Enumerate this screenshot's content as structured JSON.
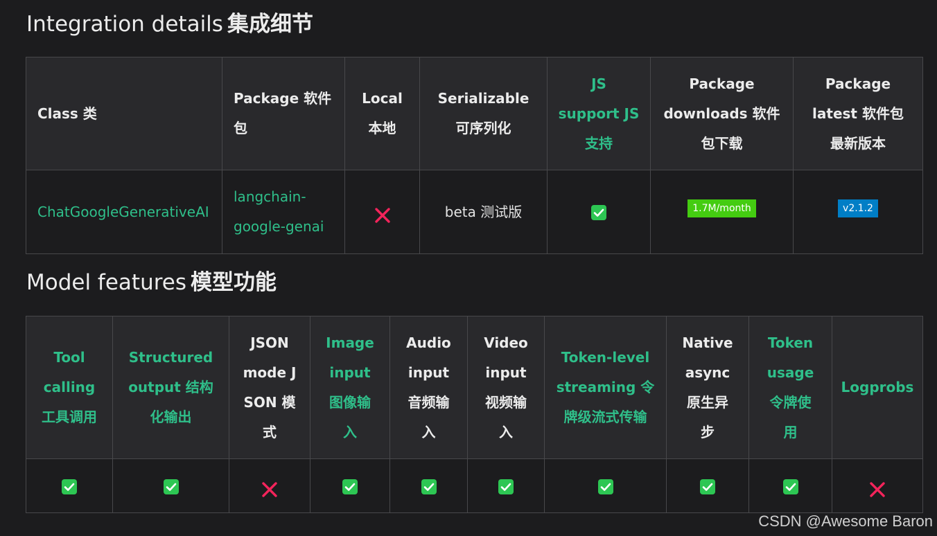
{
  "integration": {
    "title_en": "Integration details",
    "title_cn": "集成细节",
    "headers": [
      {
        "lines": [
          "Class 类"
        ]
      },
      {
        "lines": [
          "Package 软件",
          "包"
        ]
      },
      {
        "lines": [
          "Local",
          "本地"
        ]
      },
      {
        "lines": [
          "Serializable",
          "可序列化"
        ]
      },
      {
        "lines": [
          "JS",
          "support JS",
          "支持"
        ]
      },
      {
        "lines": [
          "Package",
          "downloads 软件",
          "包下载"
        ]
      },
      {
        "lines": [
          "Package",
          "latest 软件包",
          "最新版本"
        ]
      }
    ],
    "row": {
      "class_name": "ChatGoogleGenerativeAI",
      "package_lines": [
        "langchain-",
        "google-genai"
      ],
      "local": "cross-icon",
      "serializable": "beta 测试版",
      "js_support": "check-icon",
      "downloads_badge": "1.7M/month",
      "version_badge": "v2.1.2"
    }
  },
  "features": {
    "title_en": "Model features",
    "title_cn": "模型功能",
    "headers": [
      {
        "lines": [
          "Tool",
          "calling",
          "工具调用"
        ],
        "link": true
      },
      {
        "lines": [
          "Structured",
          "output 结构",
          "化输出"
        ],
        "link": true
      },
      {
        "lines": [
          "JSON",
          "mode J",
          "SON 模",
          "式"
        ],
        "link": false
      },
      {
        "lines": [
          "Image",
          "input",
          "图像输",
          "入"
        ],
        "link": true
      },
      {
        "lines": [
          "Audio",
          "input",
          "音频输",
          "入"
        ],
        "link": false
      },
      {
        "lines": [
          "Video",
          "input",
          "视频输",
          "入"
        ],
        "link": false
      },
      {
        "lines": [
          "Token-level",
          "streaming 令",
          "牌级流式传输"
        ],
        "link": true
      },
      {
        "lines": [
          "Native",
          "async",
          "原生异",
          "步"
        ],
        "link": false
      },
      {
        "lines": [
          "Token",
          "usage",
          "令牌使",
          "用"
        ],
        "link": true
      },
      {
        "lines": [
          "Logprobs"
        ],
        "link": true
      }
    ],
    "values": [
      "check",
      "check",
      "cross",
      "check",
      "check",
      "check",
      "check",
      "check",
      "check",
      "cross"
    ]
  },
  "colors": {
    "link": "#2fbf8a",
    "check_bg": "#2dc653",
    "cross": "#f4245b",
    "badge_green": "#44cc11",
    "badge_blue": "#007ec6"
  },
  "watermark": "CSDN @Awesome Baron"
}
